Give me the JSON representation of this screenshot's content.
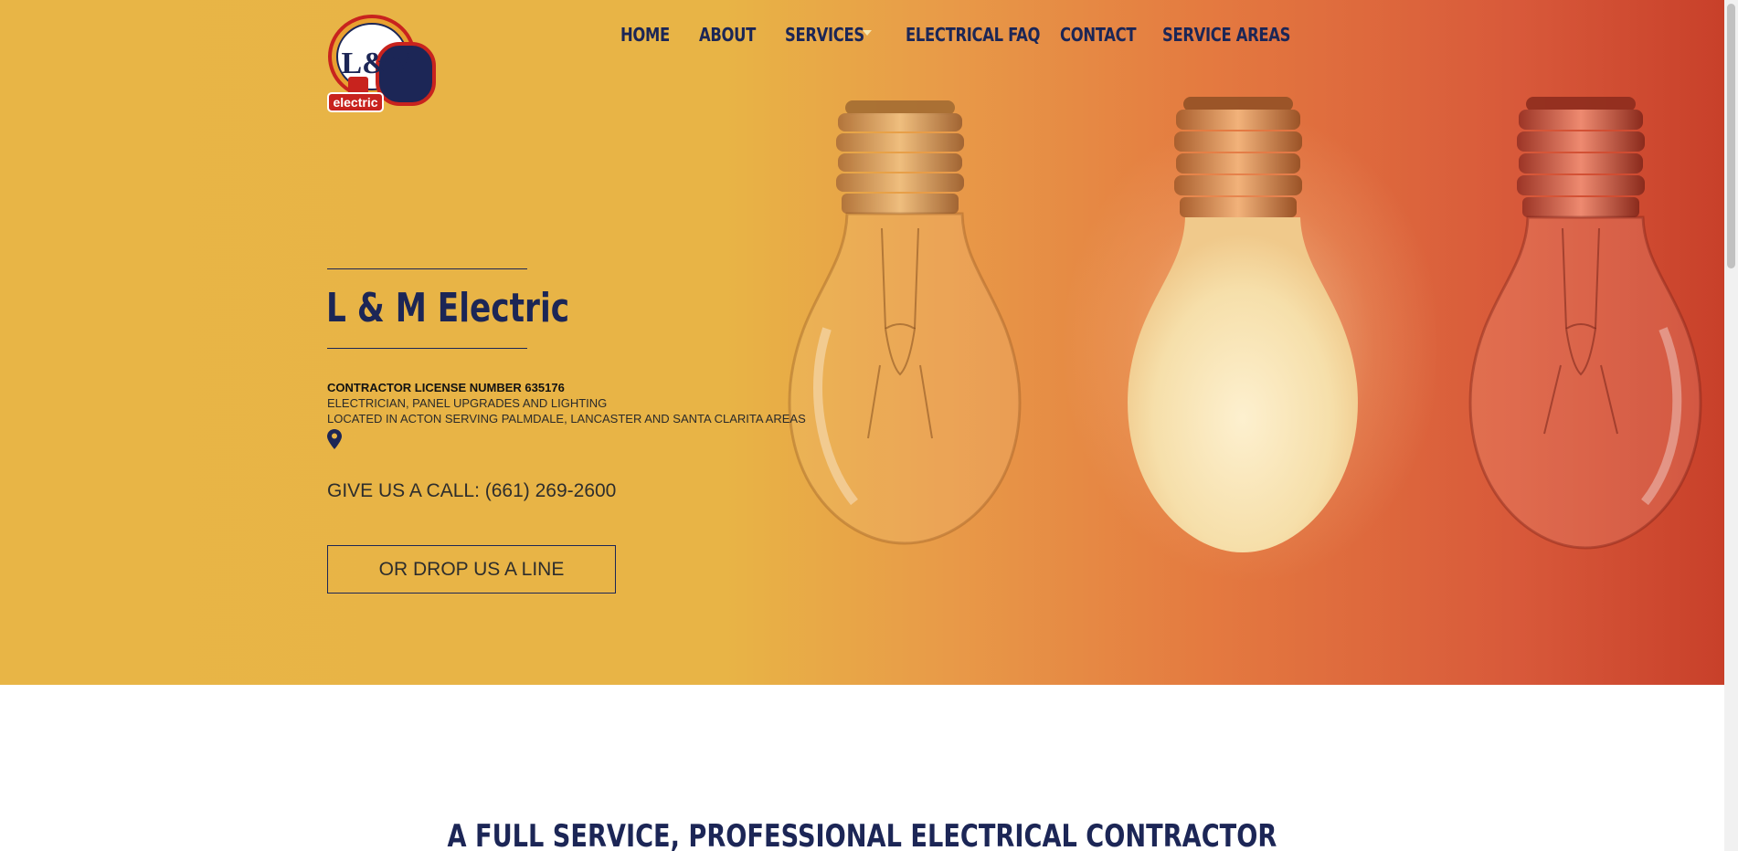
{
  "brand": {
    "name": "L & M Electric",
    "logo_text_top": "L&M",
    "logo_text_bottom": "electric"
  },
  "nav": {
    "items": [
      {
        "label": "HOME"
      },
      {
        "label": "ABOUT"
      },
      {
        "label": "SERVICES"
      },
      {
        "label": "ELECTRICAL FAQ"
      },
      {
        "label": "CONTACT"
      },
      {
        "label": "SERVICE AREAS"
      }
    ]
  },
  "hero": {
    "title": "L & M Electric",
    "license": "CONTRACTOR LICENSE NUMBER 635176",
    "tagline_1": "ELECTRICIAN, PANEL UPGRADES AND LIGHTING",
    "tagline_2": "LOCATED IN ACTON SERVING PALMDALE, LANCASTER AND SANTA CLARITA AREAS",
    "call": "GIVE US A CALL: (661) 269-2600",
    "cta": "OR DROP US A LINE"
  },
  "section": {
    "title": "A FULL SERVICE, PROFESSIONAL ELECTRICAL CONTRACTOR"
  },
  "icons": {
    "location": "map-pin-icon",
    "dropdown": "caret-down-icon"
  },
  "colors": {
    "navy": "#1c2656",
    "hero_yellow": "#e8b546",
    "hero_red": "#c8402a"
  }
}
